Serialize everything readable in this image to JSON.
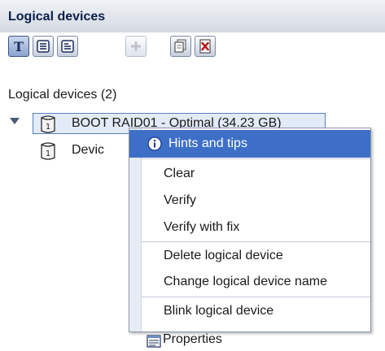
{
  "header": {
    "title": "Logical devices"
  },
  "toolbar": {
    "buttons": [
      {
        "name": "text-view-button",
        "icon": "text-icon",
        "state": "active"
      },
      {
        "name": "list-view-button",
        "icon": "list-icon",
        "state": "normal"
      },
      {
        "name": "detail-view-button",
        "icon": "detail-icon",
        "state": "normal"
      },
      {
        "name": "add-device-button",
        "icon": "plus-icon",
        "state": "disabled"
      },
      {
        "name": "copy-device-button",
        "icon": "copy-icon",
        "state": "normal"
      },
      {
        "name": "delete-device-button",
        "icon": "delete-icon",
        "state": "normal"
      }
    ]
  },
  "tree": {
    "title": "Logical devices (2)",
    "items": [
      {
        "label": "BOOT RAID01 - Optimal (34.23 GB)",
        "selected": true
      },
      {
        "label": "Devic"
      }
    ]
  },
  "context_menu": {
    "items": [
      {
        "label": "Hints and tips",
        "icon": "info-icon",
        "highlighted": true
      },
      {
        "label": "Clear"
      },
      {
        "label": "Verify"
      },
      {
        "label": "Verify with fix"
      },
      {
        "label": "Delete logical device"
      },
      {
        "label": "Change logical device name"
      },
      {
        "label": "Blink logical device"
      },
      {
        "label": "Properties",
        "icon": "properties-icon"
      }
    ]
  },
  "colors": {
    "highlight": "#3d6fc7",
    "header_text": "#0b1f4a"
  }
}
